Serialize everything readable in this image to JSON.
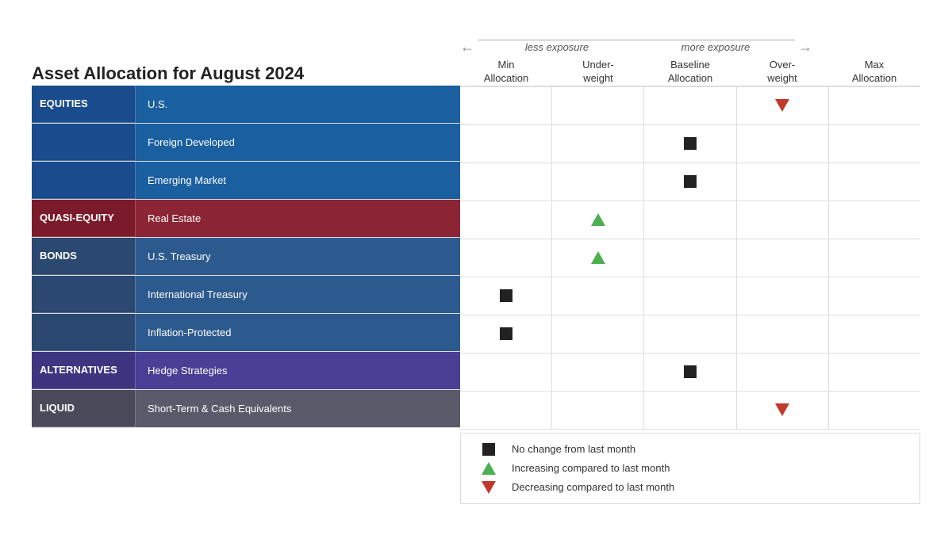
{
  "title": "Asset Allocation for August 2024",
  "exposure": {
    "less": "less exposure",
    "more": "more exposure"
  },
  "columns": [
    {
      "id": "min",
      "label": "Min\nAllocation"
    },
    {
      "id": "under",
      "label": "Under-\nweight"
    },
    {
      "id": "baseline",
      "label": "Baseline\nAllocation"
    },
    {
      "id": "over",
      "label": "Over-\nweight"
    },
    {
      "id": "max",
      "label": "Max\nAllocation"
    }
  ],
  "rows": [
    {
      "category": "EQUITIES",
      "catClass": "equities-cat",
      "subClass": "equities-sub",
      "sub": "U.S.",
      "symbols": {
        "over": "triangle-down-red"
      }
    },
    {
      "category": "",
      "catClass": "equities-cat",
      "subClass": "equities-sub",
      "sub": "Foreign Developed",
      "symbols": {
        "baseline": "square"
      }
    },
    {
      "category": "",
      "catClass": "equities-cat",
      "subClass": "equities-sub",
      "sub": "Emerging Market",
      "symbols": {
        "baseline": "square"
      }
    },
    {
      "category": "QUASI-EQUITY",
      "catClass": "quasi-cat",
      "subClass": "quasi-sub",
      "sub": "Real Estate",
      "symbols": {
        "under": "triangle-up-green"
      }
    },
    {
      "category": "BONDS",
      "catClass": "bonds-cat",
      "subClass": "bonds-sub",
      "sub": "U.S. Treasury",
      "symbols": {
        "under": "triangle-up-green"
      }
    },
    {
      "category": "",
      "catClass": "bonds-cat",
      "subClass": "bonds-sub",
      "sub": "International Treasury",
      "symbols": {
        "min": "square"
      }
    },
    {
      "category": "",
      "catClass": "bonds-cat",
      "subClass": "bonds-sub",
      "sub": "Inflation-Protected",
      "symbols": {
        "min": "square"
      }
    },
    {
      "category": "ALTERNATIVES",
      "catClass": "alts-cat",
      "subClass": "alts-sub",
      "sub": "Hedge Strategies",
      "symbols": {
        "baseline": "square"
      }
    },
    {
      "category": "LIQUID",
      "catClass": "liquid-cat",
      "subClass": "liquid-sub",
      "sub": "Short-Term & Cash Equivalents",
      "symbols": {
        "over": "triangle-down-red"
      }
    }
  ],
  "legend": [
    {
      "symbol": "square",
      "text": "No change from last month"
    },
    {
      "symbol": "triangle-up",
      "text": "Increasing compared to last month"
    },
    {
      "symbol": "triangle-down",
      "text": "Decreasing compared to last month"
    }
  ]
}
